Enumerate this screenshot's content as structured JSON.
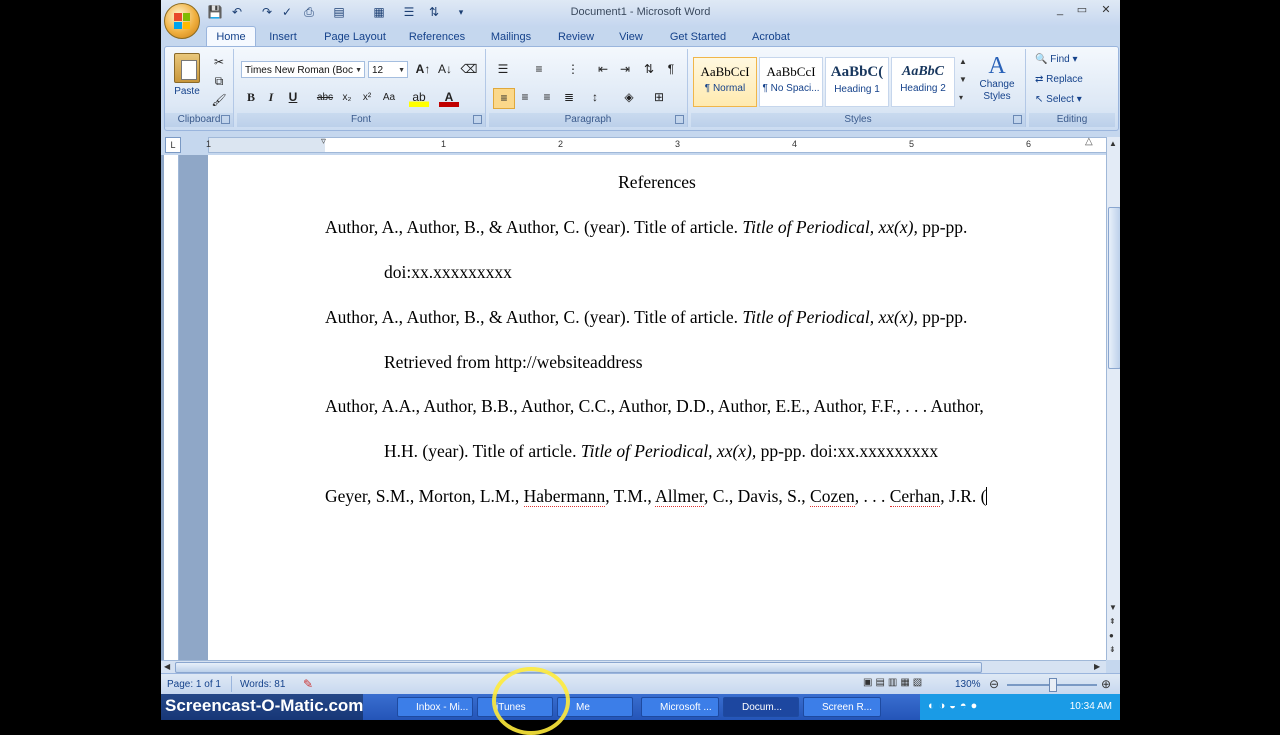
{
  "window": {
    "title": "Document1 - Microsoft Word",
    "minimize": "_",
    "restore": "▭",
    "close": "✕"
  },
  "tabs": [
    "Home",
    "Insert",
    "Page Layout",
    "References",
    "Mailings",
    "Review",
    "View",
    "Get Started",
    "Acrobat"
  ],
  "ribbon": {
    "clipboard": {
      "label": "Clipboard",
      "paste": "Paste"
    },
    "font": {
      "label": "Font",
      "font_name": "Times New Roman (Boc",
      "font_size": "12"
    },
    "paragraph": {
      "label": "Paragraph"
    },
    "styles": {
      "label": "Styles",
      "items": [
        {
          "preview": "AaBbCcI",
          "name": "¶ Normal"
        },
        {
          "preview": "AaBbCcI",
          "name": "¶ No Spaci..."
        },
        {
          "preview": "AaBbC(",
          "name": "Heading 1"
        },
        {
          "preview": "AaBbC",
          "name": "Heading 2"
        }
      ],
      "change_styles": "Change Styles"
    },
    "editing": {
      "label": "Editing",
      "find": "Find",
      "replace": "Replace",
      "select": "Select"
    }
  },
  "ruler": {
    "numbers": [
      "1",
      "1",
      "2",
      "3",
      "4",
      "5",
      "6"
    ]
  },
  "document": {
    "heading": "References",
    "lines": [
      {
        "text": "Author, A., Author, B., & Author, C. (year). Title of article. ",
        "italic": "Title of Periodical, xx(x),",
        "tail": " pp-pp."
      },
      {
        "text": "doi:xx.xxxxxxxxx"
      },
      {
        "text": "Author, A., Author, B., & Author, C. (year). Title of article. ",
        "italic": "Title of Periodical, xx(x),",
        "tail": " pp-pp."
      },
      {
        "text": "Retrieved from http://websiteaddress"
      },
      {
        "text": "Author, A.A., Author, B.B., Author, C.C., Author, D.D., Author, E.E., Author, F.F., . . . Author,"
      },
      {
        "text": "H.H. (year). Title of article. ",
        "italic": "Title of Periodical, xx(x),",
        "tail": " pp-pp. doi:xx.xxxxxxxxx"
      },
      {
        "parts": [
          "Geyer, S.M., Morton, L.M., ",
          "Habermann",
          ", T.M., ",
          "Allmer",
          ", C., Davis, S., ",
          "Cozen",
          ", . . . ",
          "Cerhan",
          ", J.R. ("
        ]
      }
    ]
  },
  "status": {
    "page": "Page: 1 of 1",
    "words": "Words: 81",
    "zoom": "130%"
  },
  "taskbar": {
    "recorder": "Screencast-O-Matic.com",
    "tasks": [
      "Inbox - Mi...",
      "iTunes",
      "Me",
      "Microsoft ...",
      "Docum...",
      "Screen R..."
    ],
    "clock": "10:34 AM"
  }
}
